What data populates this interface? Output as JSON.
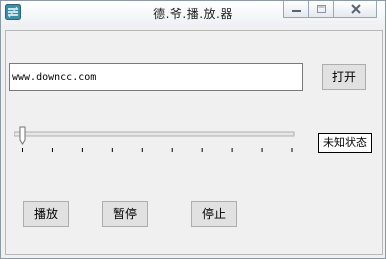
{
  "window": {
    "title": "德.爷.播.放.器",
    "icon": "app-icon",
    "controls": [
      "minimize-icon",
      "maximize-icon",
      "close-icon"
    ]
  },
  "url_input": {
    "value": "www.downcc.com"
  },
  "open_button": {
    "label": "打开"
  },
  "progress_slider": {
    "value": 0,
    "tick_count": 10
  },
  "status": {
    "text": "未知状态"
  },
  "buttons": {
    "play": "播放",
    "pause": "暂停",
    "stop": "停止"
  }
}
